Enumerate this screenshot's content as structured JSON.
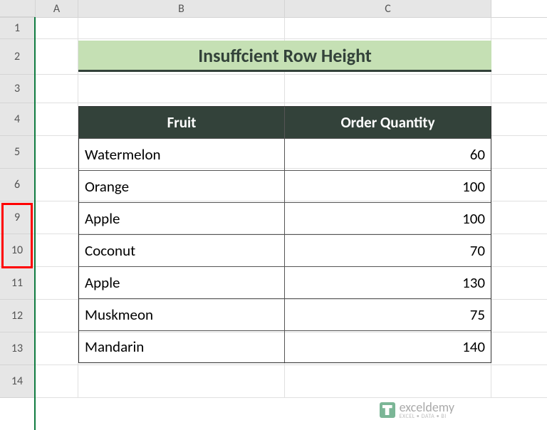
{
  "columns": {
    "a": "A",
    "b": "B",
    "c": "C"
  },
  "rows": {
    "r1": "1",
    "r2": "2",
    "r3": "3",
    "r4": "4",
    "r5": "5",
    "r6": "6",
    "r9": "9",
    "r10": "10",
    "r11": "11",
    "r12": "12",
    "r13": "13",
    "r14": "14"
  },
  "title": "Insuffcient Row Height",
  "table": {
    "headers": {
      "fruit": "Fruit",
      "qty": "Order Quantity"
    },
    "rows": [
      {
        "fruit": "Watermelon",
        "qty": "60"
      },
      {
        "fruit": "Orange",
        "qty": "100"
      },
      {
        "fruit": "Apple",
        "qty": "100"
      },
      {
        "fruit": "Coconut",
        "qty": "70"
      },
      {
        "fruit": "Apple",
        "qty": "130"
      },
      {
        "fruit": "Muskmeon",
        "qty": "75"
      },
      {
        "fruit": "Mandarin",
        "qty": "140"
      }
    ]
  },
  "watermark": {
    "main": "exceldemy",
    "sub": "EXCEL • DATA • BI"
  }
}
